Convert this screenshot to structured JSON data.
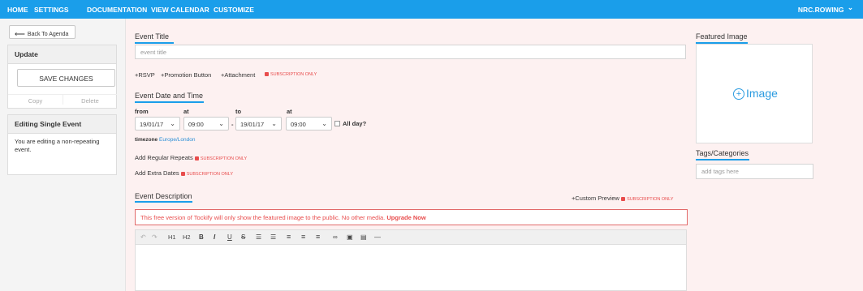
{
  "nav": {
    "items": [
      "HOME",
      "SETTINGS",
      "DOCUMENTATION",
      "VIEW CALENDAR",
      "CUSTOMIZE"
    ],
    "user": "NRC.ROWING",
    "user_caret": "⌄"
  },
  "sidebar": {
    "back_label": "Back To Agenda",
    "update": {
      "title": "Update",
      "save_label": "SAVE CHANGES",
      "copy_label": "Copy",
      "delete_label": "Delete"
    },
    "editing": {
      "title": "Editing Single Event",
      "text": "You are editing a non-repeating event."
    }
  },
  "event": {
    "title_label": "Event Title",
    "title_placeholder": "event title",
    "add_links": [
      "+RSVP",
      "+Promotion Button",
      "+Attachment"
    ],
    "subscription_label": "SUBSCRIPTION ONLY",
    "date_section": "Event Date and Time",
    "from_label": "from",
    "at_label": "at",
    "to_label": "to",
    "from_date": "19/01/17",
    "from_time": "09:00",
    "dash": "-",
    "to_date": "19/01/17",
    "to_time": "09:00",
    "all_day_label": "All day?",
    "timezone_label": "timezone",
    "timezone_value": "Europe/London",
    "repeats_label": "Add Regular Repeats",
    "extra_dates_label": "Add Extra Dates",
    "description_label": "Event Description",
    "custom_preview_label": "+Custom Preview",
    "warning_text": "This free version of Tockify will only show the featured image to the public. No other media.",
    "upgrade_label": "Upgrade Now",
    "toolbar": {
      "undo": "↶",
      "redo": "↷",
      "h1": "H1",
      "h2": "H2",
      "bold": "B",
      "italic": "I",
      "underline": "U",
      "strike": "S",
      "ul": "☰",
      "ol": "☰",
      "align_left": "≡",
      "align_center": "≡",
      "align_right": "≡",
      "link": "∞",
      "image": "▣",
      "video": "▤",
      "hr": "—"
    }
  },
  "right": {
    "featured_label": "Featured Image",
    "image_label": "Image",
    "image_plus": "+",
    "tags_label": "Tags/Categories",
    "tags_placeholder": "add tags here"
  },
  "colors": {
    "accent": "#1a9eea",
    "warning": "#e84c4c",
    "background": "#fdf1f1"
  }
}
